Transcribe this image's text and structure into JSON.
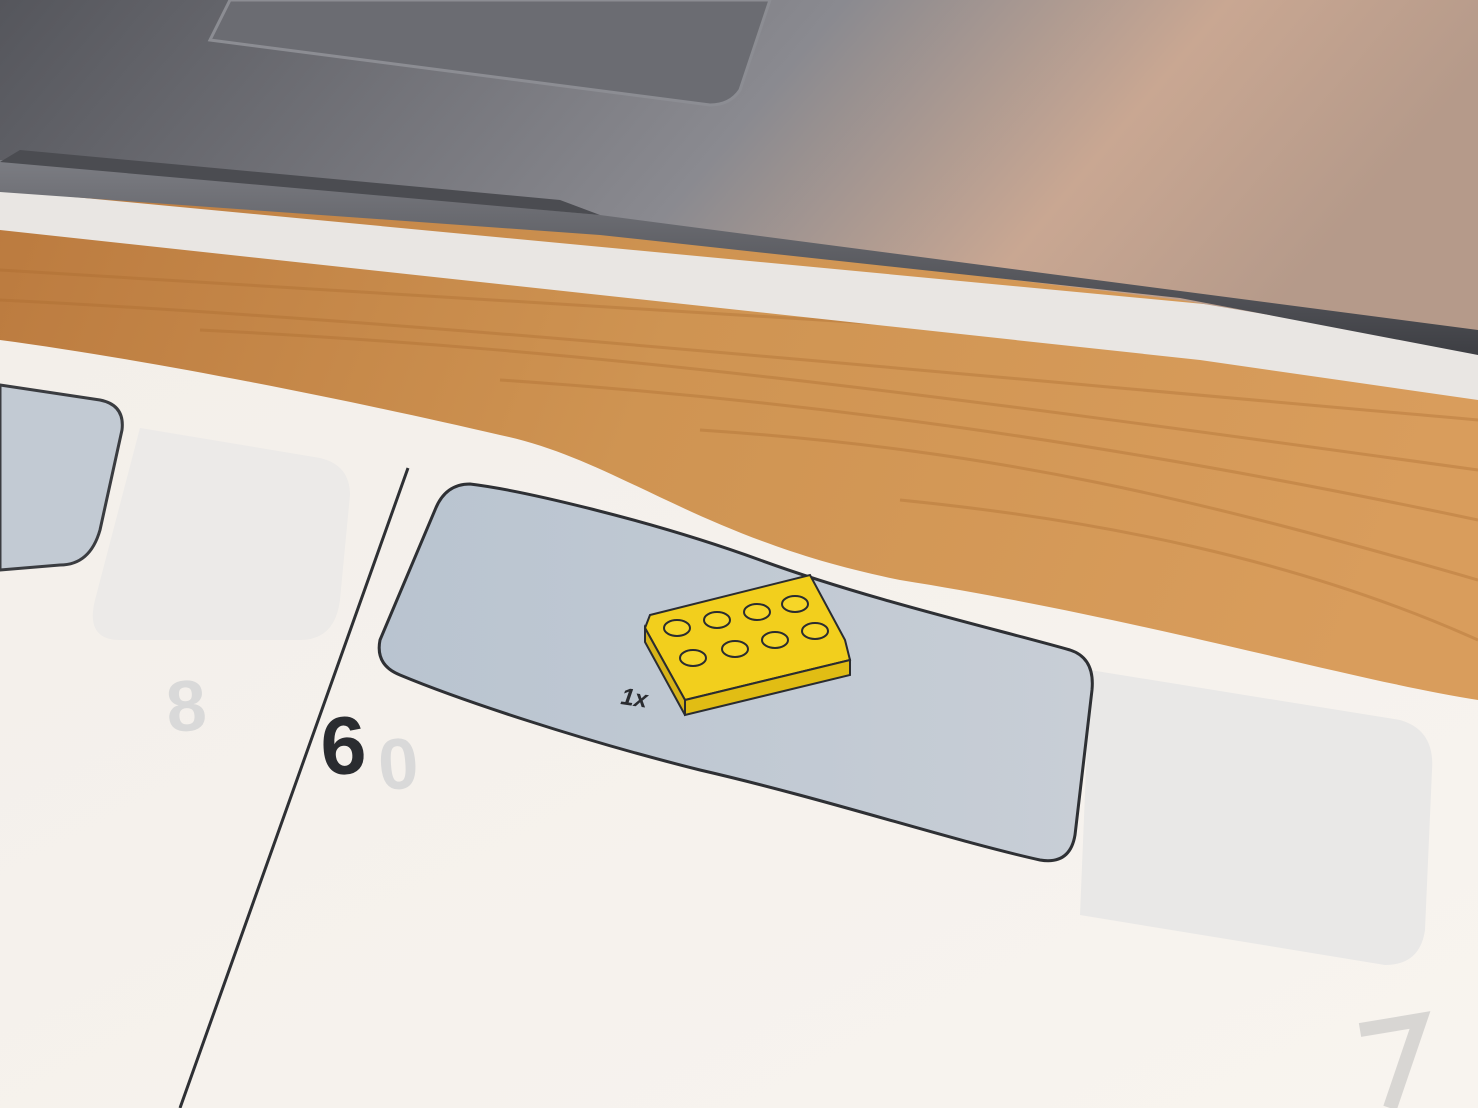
{
  "scene": {
    "description_colors": {
      "wood": "#c98b4b",
      "laptop": "#6e6f75",
      "paper": "#f6f3ef",
      "panel": "#c3cbd4",
      "brick": "#f3d21b"
    }
  },
  "instruction_sheet": {
    "step_number": "6",
    "parts_callout": {
      "quantity_label": "1x",
      "part_icon": "yellow-2x4-plate-icon"
    },
    "ghost_numbers": [
      "8",
      "0"
    ]
  }
}
